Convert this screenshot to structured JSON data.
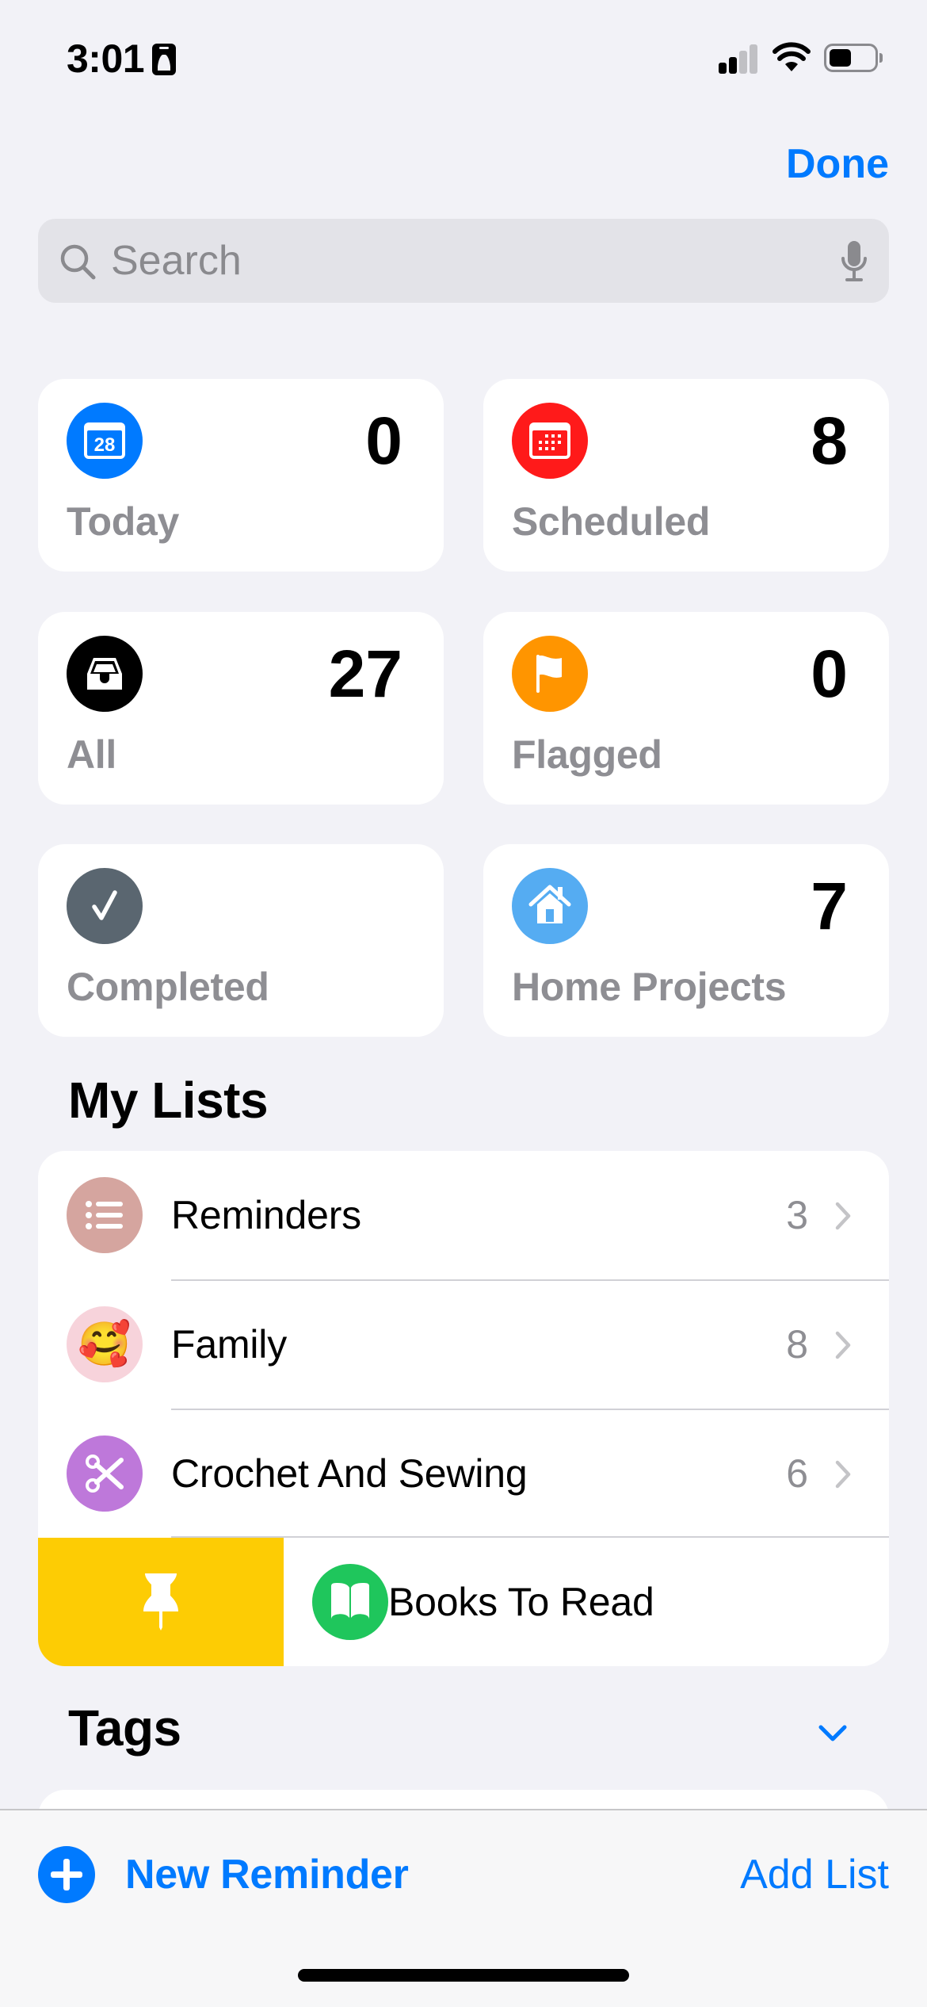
{
  "status_bar": {
    "time": "3:01",
    "focus_icon": "person-badge-icon",
    "signal_bars_active": 2,
    "signal_bars_total": 4,
    "wifi_icon": "wifi-icon",
    "battery_percent": 50
  },
  "nav": {
    "done_label": "Done"
  },
  "search": {
    "placeholder": "Search",
    "value": "",
    "icon": "search-icon",
    "mic_icon": "mic-icon"
  },
  "smart_lists": [
    {
      "id": "today",
      "label": "Today",
      "count": "0",
      "icon": "calendar-today-icon",
      "icon_text": "28",
      "color": "#007AFF"
    },
    {
      "id": "scheduled",
      "label": "Scheduled",
      "count": "8",
      "icon": "calendar-icon",
      "color": "#FF1A1A"
    },
    {
      "id": "all",
      "label": "All",
      "count": "27",
      "icon": "tray-icon",
      "color": "#000000"
    },
    {
      "id": "flagged",
      "label": "Flagged",
      "count": "0",
      "icon": "flag-icon",
      "color": "#FF9500"
    },
    {
      "id": "completed",
      "label": "Completed",
      "count": "",
      "icon": "checkmark-icon",
      "color": "#5A6670"
    },
    {
      "id": "home-projects",
      "label": "Home Projects",
      "count": "7",
      "icon": "house-icon",
      "color": "#55ACF2"
    }
  ],
  "my_lists": {
    "title": "My Lists",
    "items": [
      {
        "label": "Reminders",
        "count": "3",
        "icon": "list-bullet-icon",
        "color": "#D5A59F"
      },
      {
        "label": "Family",
        "count": "8",
        "icon": "smiling-face-hearts-emoji",
        "emoji": "🥰",
        "color": "#F7D3DB"
      },
      {
        "label": "Crochet And Sewing",
        "count": "6",
        "icon": "scissors-icon",
        "color": "#BE78DA"
      },
      {
        "label": "Books To Read",
        "count": "",
        "icon": "book-icon",
        "color": "#1FC65C"
      }
    ],
    "swipe_action": {
      "label": "Pin",
      "icon": "pin-icon",
      "color": "#FDCC04"
    }
  },
  "tags": {
    "title": "Tags",
    "expanded": true
  },
  "toolbar": {
    "new_reminder_label": "New Reminder",
    "add_list_label": "Add List"
  },
  "accent_color": "#007AFF"
}
